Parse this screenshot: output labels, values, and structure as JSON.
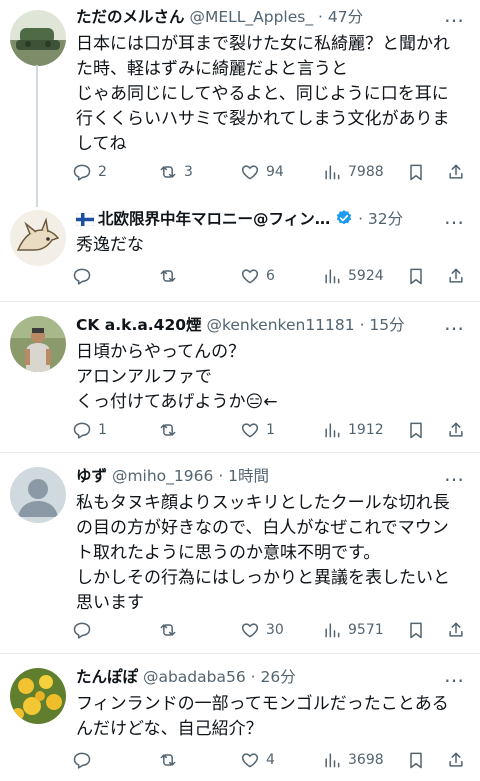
{
  "more_label": "…",
  "tweets": [
    {
      "name": "ただのメルさん",
      "handle": "@MELL_Apples_",
      "time": "· 47分",
      "lines": [
        "日本には口が耳まで裂けた女に私綺麗？と聞かれ",
        "た時、軽はずみに綺麗だよと言うと",
        "じゃあ同じにしてやるよと、同じように口を耳に",
        "行くくらいハサミで裂かれてしまう文化がありま",
        "してね"
      ],
      "replies": "2",
      "retweets": "3",
      "likes": "94",
      "views": "7988"
    },
    {
      "name": "北欧限界中年マロニー@フィン…",
      "handle": "",
      "time": "· 32分",
      "lines": [
        "秀逸だな"
      ],
      "replies": "",
      "retweets": "",
      "likes": "6",
      "views": "5924"
    },
    {
      "name": "CK a.k.a.420煙",
      "handle": "@kenkenken11181",
      "time": "· 15分",
      "lines": [
        "日頃からやってんの？",
        "アロンアルファで",
        "くっ付けてあげようか😑←"
      ],
      "replies": "1",
      "retweets": "",
      "likes": "1",
      "views": "1912"
    },
    {
      "name": "ゆず",
      "handle": "@miho_1966",
      "time": "· 1時間",
      "lines": [
        "私もタヌキ顔よりスッキリとしたクールな切れ長",
        "の目の方が好きなので、白人がなぜこれでマウン",
        "ト取れたように思うのか意味不明です。",
        "しかしその行為にはしっかりと異議を表したいと",
        "思います"
      ],
      "replies": "",
      "retweets": "",
      "likes": "30",
      "views": "9571"
    },
    {
      "name": "たんぽぽ",
      "handle": "@abadaba56",
      "time": "· 26分",
      "lines": [
        "フィンランドの一部ってモンゴルだったことある",
        "んだけどな、自己紹介？"
      ],
      "replies": "",
      "retweets": "",
      "likes": "4",
      "views": "3698"
    }
  ]
}
